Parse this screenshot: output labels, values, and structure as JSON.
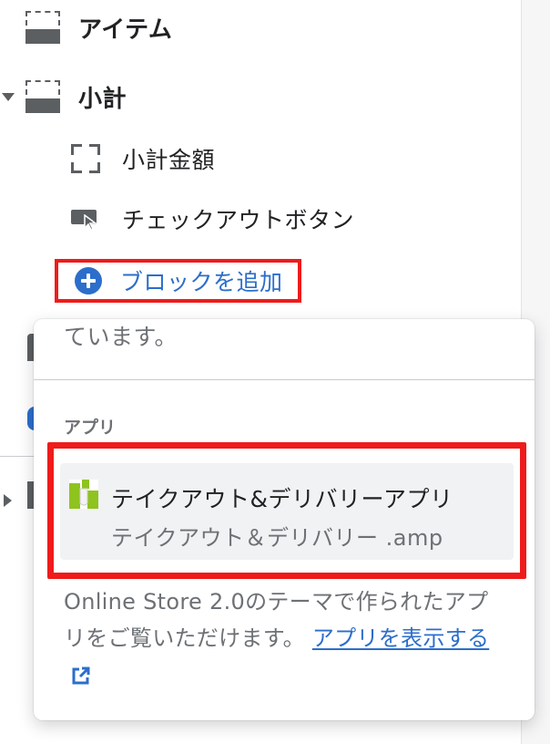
{
  "sidebar": {
    "items_label": "アイテム",
    "subtotal_label": "小計",
    "subtotal_amount_label": "小計金額",
    "checkout_button_label": "チェックアウトボタン",
    "add_block_label": "ブロックを追加"
  },
  "popover": {
    "truncated_text": "ています。",
    "apps_heading": "アプリ",
    "app": {
      "name": "テイクアウト&デリバリーアプリ",
      "subtitle": "テイクアウト＆デリバリー .amp"
    },
    "info_text": "Online Store 2.0のテーマで作られたアプリをご覧いただけます。",
    "view_apps_link": "アプリを表示する"
  },
  "colors": {
    "accent": "#2c6ecb",
    "highlight": "#ef1b1b",
    "icon": "#5c5f62",
    "app_icon_green": "#8fc31f"
  },
  "icons": [
    "section-icon",
    "corners-icon",
    "button-cursor-icon",
    "plus-circle-icon",
    "app-logo-icon",
    "external-link-icon"
  ]
}
